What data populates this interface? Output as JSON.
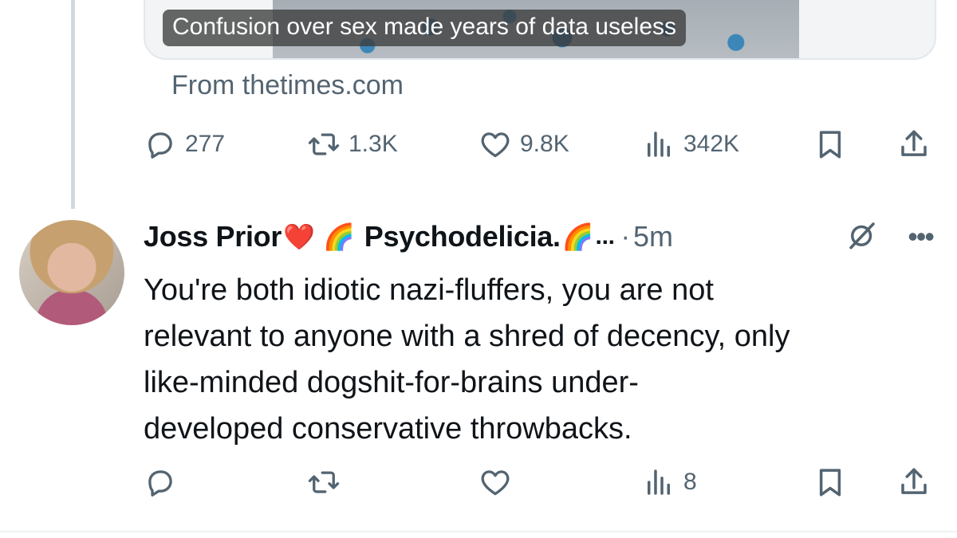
{
  "quoted_card": {
    "caption": "Confusion over sex made years of data useless",
    "source": "From thetimes.com"
  },
  "first_tweet_actions": {
    "replies": "277",
    "reposts": "1.3K",
    "likes": "9.8K",
    "views": "342K"
  },
  "reply_tweet": {
    "display_name": "Joss Prior",
    "name_emoji_1": "❤️",
    "name_emoji_2": "🌈",
    "name_rest": "Psychodelicia.",
    "name_emoji_3": "🌈",
    "ellipsis": "...",
    "separator": "·",
    "timestamp": "5m",
    "body_lines": [
      "You're both idiotic nazi-fluffers, you are not",
      "relevant to anyone with a shred of decency, only",
      "like-minded dogshit-for-brains under-",
      "developed conservative throwbacks."
    ],
    "actions": {
      "replies": "",
      "reposts": "",
      "likes": "",
      "views": "8"
    }
  },
  "icons": {
    "reply": "reply-icon",
    "retweet": "retweet-icon",
    "like": "heart-icon",
    "views": "views-icon",
    "bookmark": "bookmark-icon",
    "share": "share-icon",
    "grok": "grok-icon",
    "more": "more-icon"
  },
  "colors": {
    "text": "#0f1419",
    "secondary": "#536471",
    "thread_line": "#cfd9de"
  }
}
